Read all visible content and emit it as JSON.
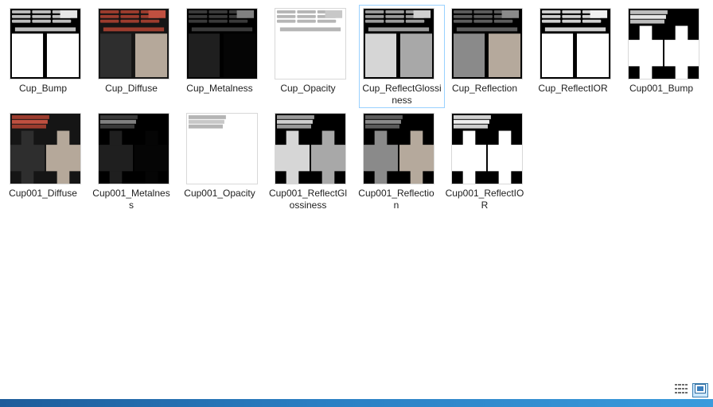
{
  "window": {
    "title": ""
  },
  "files": [
    {
      "name": "Cup_Bump",
      "preview": "bump-uv",
      "selected": false
    },
    {
      "name": "Cup_Diffuse",
      "preview": "diffuse-uv",
      "selected": false
    },
    {
      "name": "Cup_Metalness",
      "preview": "metal-uv",
      "selected": false
    },
    {
      "name": "Cup_Opacity",
      "preview": "opacity-uv",
      "selected": false
    },
    {
      "name": "Cup_ReflectGlossiness",
      "preview": "gloss-uv",
      "selected": true
    },
    {
      "name": "Cup_Reflection",
      "preview": "reflection-uv",
      "selected": false
    },
    {
      "name": "Cup_ReflectIOR",
      "preview": "ior-uv",
      "selected": false
    },
    {
      "name": "Cup001_Bump",
      "preview": "bump-cross",
      "selected": false
    },
    {
      "name": "Cup001_Diffuse",
      "preview": "diffuse-cross",
      "selected": false
    },
    {
      "name": "Cup001_Metalness",
      "preview": "metal-cross",
      "selected": false
    },
    {
      "name": "Cup001_Opacity",
      "preview": "opacity-cross",
      "selected": false
    },
    {
      "name": "Cup001_ReflectGlossiness",
      "preview": "gloss-cross",
      "selected": false
    },
    {
      "name": "Cup001_Reflection",
      "preview": "reflection-cross",
      "selected": false
    },
    {
      "name": "Cup001_ReflectIOR",
      "preview": "ior-cross",
      "selected": false
    }
  ],
  "view_controls": [
    {
      "icon": "details-view-icon",
      "active": false
    },
    {
      "icon": "large-icons-view-icon",
      "active": true
    }
  ],
  "colors": {
    "selection_border": "#99d1ff",
    "taskbar": "#2a7fc3"
  }
}
